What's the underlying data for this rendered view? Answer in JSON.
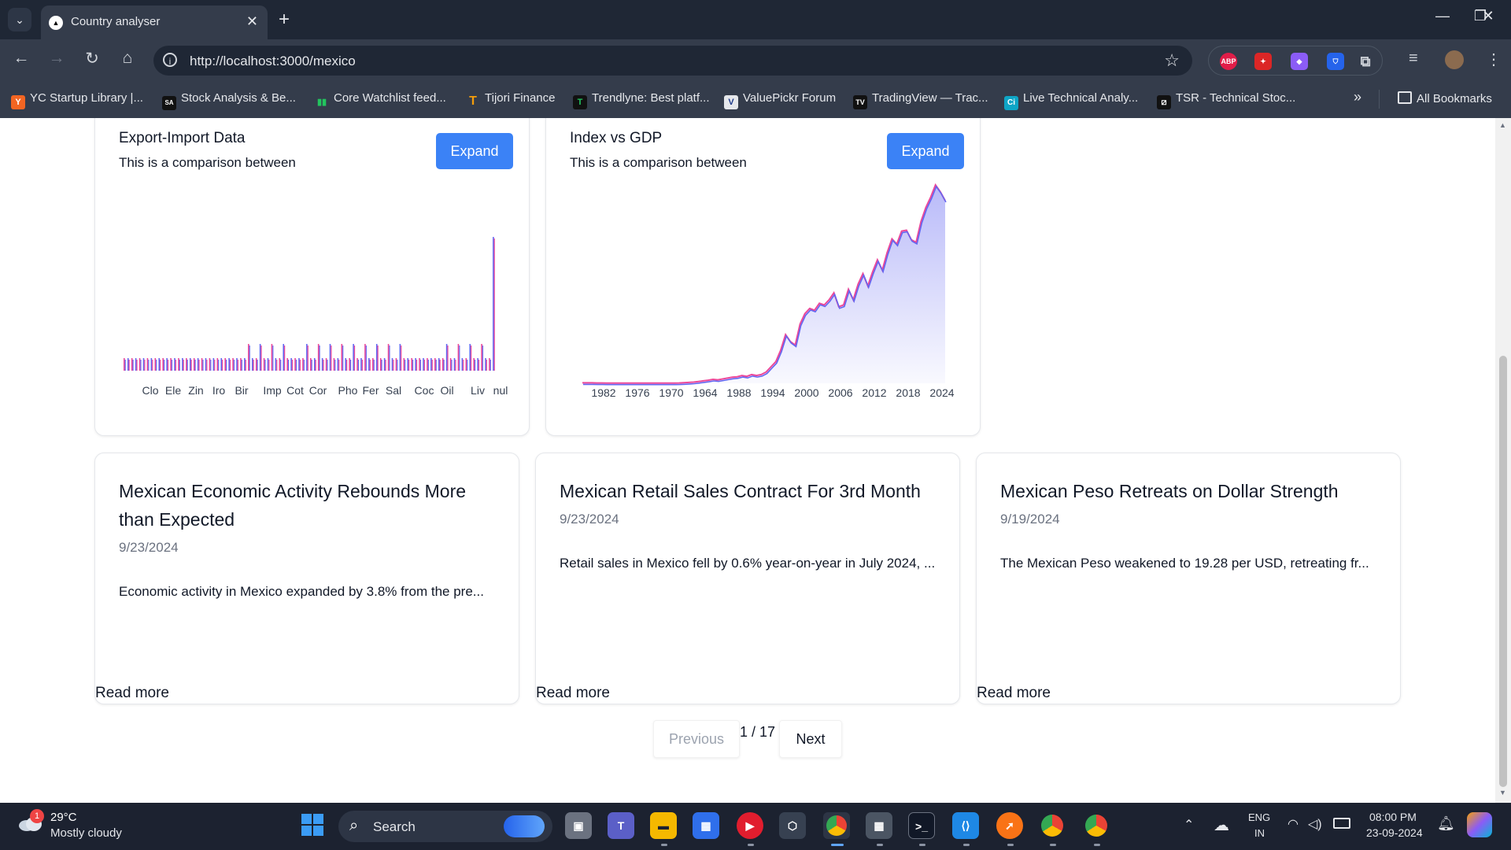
{
  "browser": {
    "tab_title": "Country analyser",
    "url": "http://localhost:3000/mexico",
    "bookmarks": [
      {
        "label": "YC Startup Library |...",
        "icon": "Y",
        "color": "#f26522"
      },
      {
        "label": "Stock Analysis & Be...",
        "icon": "SA",
        "color": "#111111"
      },
      {
        "label": "Core Watchlist feed...",
        "icon": "▮",
        "color": "#22c55e"
      },
      {
        "label": "Tijori Finance",
        "icon": "T",
        "color": "#f59e0b"
      },
      {
        "label": "Trendlyne: Best platf...",
        "icon": "T",
        "color": "#111111"
      },
      {
        "label": "ValuePickr Forum",
        "icon": "V",
        "color": "#e5e7eb"
      },
      {
        "label": "TradingView — Trac...",
        "icon": "TV",
        "color": "#111111"
      },
      {
        "label": "Live Technical Analy...",
        "icon": "Ci",
        "color": "#0ea5c6"
      },
      {
        "label": "TSR - Technical Stoc...",
        "icon": "⧄",
        "color": "#111111"
      }
    ],
    "all_bookmarks": "All Bookmarks",
    "extensions": [
      {
        "label": "ABP",
        "color": "#e11d48"
      },
      {
        "label": "✦",
        "color": "#dc2626"
      },
      {
        "label": "◆",
        "color": "#8b5cf6"
      },
      {
        "label": "⛉",
        "color": "#2563eb"
      }
    ]
  },
  "charts": [
    {
      "title": "Export-Import Data",
      "subtitle": "This is a comparison between",
      "expand_label": "Expand",
      "chart_data": {
        "type": "bar",
        "categories": [
          "Clo",
          "Ele",
          "Zin",
          "Iro",
          "Bir",
          "Imp",
          "Cot",
          "Cor",
          "Pho",
          "Fer",
          "Sal",
          "Coc",
          "Oil",
          "Liv",
          "nul"
        ],
        "note_values": "thin paired bars, most near-equal small heights, a few slightly taller, final 'nul' bar tallest",
        "series": [
          {
            "color": "#ec4899"
          },
          {
            "color": "#6366f1"
          }
        ]
      }
    },
    {
      "title": "Index vs GDP",
      "subtitle": "This is a comparison between",
      "expand_label": "Expand",
      "chart_data": {
        "type": "area",
        "x_tick_labels": [
          "1982",
          "1976",
          "1970",
          "1964",
          "1988",
          "1994",
          "2000",
          "2006",
          "2012",
          "2018",
          "2024"
        ],
        "values": [
          0.5,
          0.5,
          0.5,
          0.4,
          0.4,
          0.3,
          0.3,
          0.3,
          0.3,
          0.3,
          0.3,
          0.3,
          0.3,
          0.3,
          0.3,
          0.3,
          0.3,
          0.3,
          0.3,
          0.3,
          0.4,
          0.6,
          1,
          1.4,
          2,
          2.8,
          3.5,
          4.5,
          4,
          5,
          6,
          7,
          7.5,
          9,
          8,
          10,
          9,
          10,
          13,
          19,
          25,
          38,
          56,
          48,
          44,
          68,
          80,
          86,
          84,
          92,
          90,
          96,
          104,
          88,
          90,
          108,
          96,
          114,
          126,
          112,
          128,
          142,
          130,
          150,
          166,
          160,
          175,
          176,
          165,
          162,
          186,
          202,
          214,
          228,
          220,
          210
        ],
        "series": [
          {
            "color": "#ec4899"
          },
          {
            "color": "#6366f1"
          }
        ]
      }
    }
  ],
  "news": [
    {
      "title": "Mexican Economic Activity Rebounds More than Expected",
      "date": "9/23/2024",
      "summary": "Economic activity in Mexico expanded by 3.8% from the pre...",
      "read_more": "Read more"
    },
    {
      "title": "Mexican Retail Sales Contract For 3rd Month",
      "date": "9/23/2024",
      "summary": "Retail sales in Mexico fell by 0.6% year-on-year in July 2024, ...",
      "read_more": "Read more"
    },
    {
      "title": "Mexican Peso Retreats on Dollar Strength",
      "date": "9/19/2024",
      "summary": "The Mexican Peso weakened to 19.28 per USD, retreating fr...",
      "read_more": "Read more"
    }
  ],
  "pagination": {
    "previous_label": "Previous",
    "status": "1 / 17",
    "next_label": "Next"
  },
  "taskbar": {
    "weather_badge": "1",
    "weather_temp": "29°C",
    "weather_desc": "Mostly cloudy",
    "search_label": "Search",
    "lang_top": "ENG",
    "lang_bottom": "IN",
    "time": "08:00 PM",
    "date": "23-09-2024"
  }
}
